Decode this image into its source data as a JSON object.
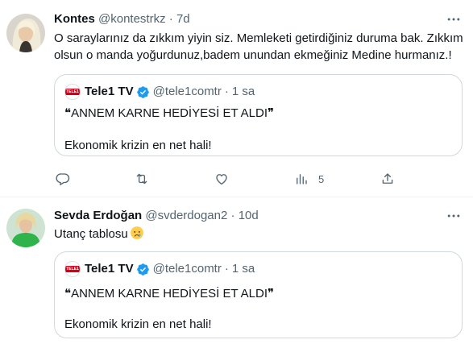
{
  "tweets": [
    {
      "name": "Kontes",
      "handle": "@kontestrkz",
      "dot": "·",
      "time": "7d",
      "text": "O saraylarınız da zıkkım yiyin siz. Memleketi getirdiğiniz duruma bak. Zıkkım olsun o manda yoğurdunuz,badem unundan ekmeğiniz Medine hurmanız.!",
      "quote": {
        "logo_text": "TELE1",
        "name": "Tele1 TV",
        "handle": "@tele1comtr",
        "dot": "·",
        "time": "1 sa",
        "line1": "❝ANNEM KARNE HEDİYESİ ET ALDI❞",
        "line2": "Ekonomik krizin en net hali!"
      },
      "actions": {
        "views_count": "5"
      }
    },
    {
      "name": "Sevda Erdoğan",
      "handle": "@svderdogan2",
      "dot": "·",
      "time": "10d",
      "text": "Utanç tablosu",
      "quote": {
        "logo_text": "TELE1",
        "name": "Tele1 TV",
        "handle": "@tele1comtr",
        "dot": "·",
        "time": "1 sa",
        "line1": "❝ANNEM KARNE HEDİYESİ ET ALDI❞",
        "line2": "Ekonomik krizin en net hali!"
      }
    }
  ],
  "colors": {
    "text": "#0f1419",
    "secondary": "#536471",
    "border": "#cfd9de",
    "verified": "#1d9bf0",
    "tele1_red": "#d0021b"
  },
  "icons": [
    "more-icon",
    "reply-icon",
    "retweet-icon",
    "like-icon",
    "views-icon",
    "share-icon",
    "verified-badge-icon",
    "crying-face-emoji"
  ]
}
